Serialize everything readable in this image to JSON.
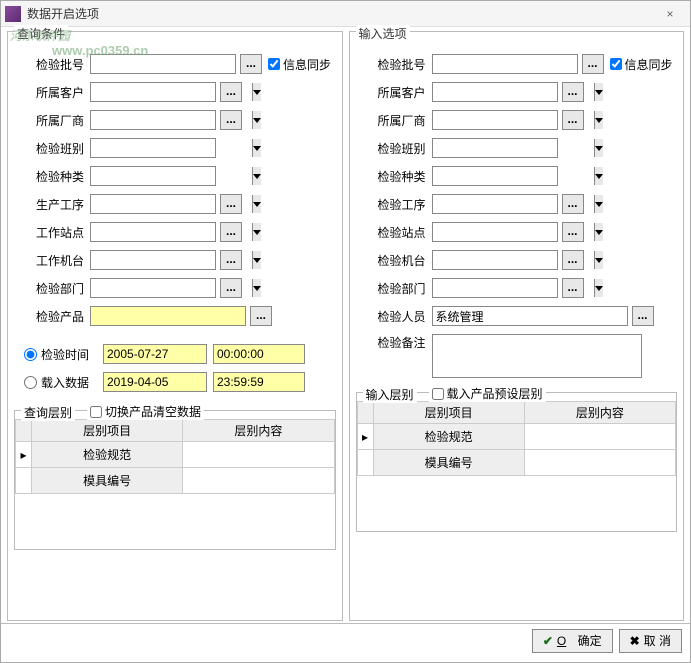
{
  "window": {
    "title": "数据开启选项",
    "close": "×"
  },
  "watermark": {
    "main": "河东软件园",
    "sub": "www.pc0359.cn"
  },
  "left": {
    "title": "查询条件",
    "rows": [
      {
        "label": "检验批号"
      },
      {
        "label": "所属客户"
      },
      {
        "label": "所属厂商"
      },
      {
        "label": "检验班别"
      },
      {
        "label": "检验种类"
      },
      {
        "label": "生产工序"
      },
      {
        "label": "工作站点"
      },
      {
        "label": "工作机台"
      },
      {
        "label": "检验部门"
      },
      {
        "label": "检验产品"
      }
    ],
    "sync": "信息同步",
    "radio1": "检验时间",
    "date1": "2005-07-27",
    "time1": "00:00:00",
    "radio2": "载入数据",
    "date2": "2019-04-05",
    "time2": "23:59:59",
    "sub": {
      "title": "查询层别",
      "chk": "切换产品清空数据",
      "col1": "层别项目",
      "col2": "层别内容",
      "r1": "检验规范",
      "r2": "模具编号"
    }
  },
  "right": {
    "title": "输入选项",
    "rows": [
      {
        "label": "检验批号"
      },
      {
        "label": "所属客户"
      },
      {
        "label": "所属厂商"
      },
      {
        "label": "检验班别"
      },
      {
        "label": "检验种类"
      },
      {
        "label": "检验工序"
      },
      {
        "label": "检验站点"
      },
      {
        "label": "检验机台"
      },
      {
        "label": "检验部门"
      },
      {
        "label": "检验人员",
        "value": "系统管理"
      }
    ],
    "sync": "信息同步",
    "remark": "检验备注",
    "sub": {
      "title": "输入层别",
      "chk": "载入产品预设层别",
      "col1": "层别项目",
      "col2": "层别内容",
      "r1": "检验规范",
      "r2": "模具编号"
    }
  },
  "footer": {
    "ok": "确定",
    "ok_key": "O",
    "cancel": "取 消"
  }
}
